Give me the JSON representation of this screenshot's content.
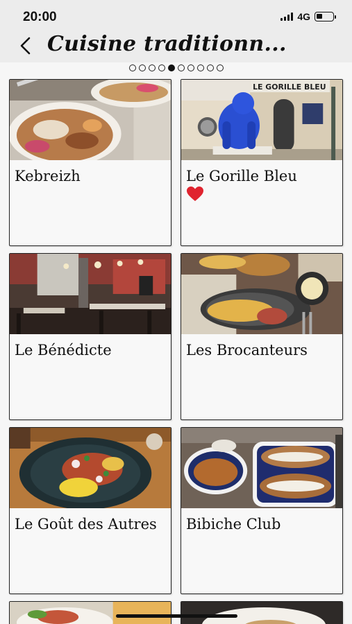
{
  "status": {
    "time": "20:00",
    "network": "4G",
    "battery_fraction": 0.35,
    "signal_icon": "signal-bars-icon",
    "battery_icon": "battery-icon"
  },
  "header": {
    "title": "Cuisine traditionn...",
    "back_icon": "chevron-left-icon"
  },
  "pager": {
    "total": 10,
    "active_index": 4
  },
  "restaurants": [
    {
      "name": "Kebreizh",
      "favorite": false
    },
    {
      "name": "Le Gorille Bleu",
      "favorite": true
    },
    {
      "name": "Le Bénédicte",
      "favorite": false
    },
    {
      "name": "Les Brocanteurs",
      "favorite": false
    },
    {
      "name": "Le Goût des Autres",
      "favorite": false
    },
    {
      "name": "Bibiche Club",
      "favorite": false
    }
  ],
  "photo_labels": {
    "gorille_sign": "LE GORILLE BLEU"
  },
  "colors": {
    "favorite_heart": "#e0242f",
    "header_bg": "#ececec"
  }
}
